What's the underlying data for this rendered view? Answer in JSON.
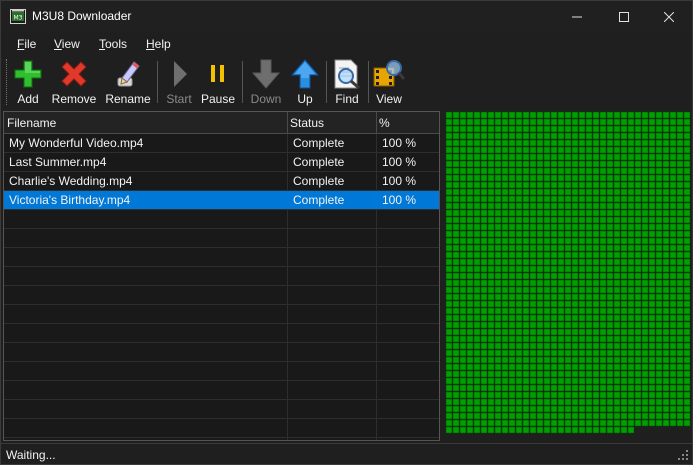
{
  "window": {
    "title": "M3U8 Downloader"
  },
  "menu": [
    {
      "label": "File",
      "u": "F",
      "rest": "ile"
    },
    {
      "label": "View",
      "u": "V",
      "rest": "iew"
    },
    {
      "label": "Tools",
      "u": "T",
      "rest": "ools"
    },
    {
      "label": "Help",
      "u": "H",
      "rest": "elp"
    }
  ],
  "toolbar": {
    "add": "Add",
    "remove": "Remove",
    "rename": "Rename",
    "start": "Start",
    "pause": "Pause",
    "down": "Down",
    "up": "Up",
    "find": "Find",
    "view": "View"
  },
  "list": {
    "columns": {
      "filename": "Filename",
      "status": "Status",
      "percent": "%"
    },
    "rows": [
      {
        "filename": "My Wonderful Video.mp4",
        "status": "Complete",
        "percent": "100 %"
      },
      {
        "filename": "Last Summer.mp4",
        "status": "Complete",
        "percent": "100 %"
      },
      {
        "filename": "Charlie's Wedding.mp4",
        "status": "Complete",
        "percent": "100 %"
      },
      {
        "filename": "Victoria's Birthday.mp4",
        "status": "Complete",
        "percent": "100 %"
      }
    ],
    "selected_index": 3
  },
  "colors": {
    "selection": "#0078d7",
    "segment_done": "#00a000",
    "segment_edge": "#004d00"
  },
  "status": {
    "text": "Waiting..."
  }
}
